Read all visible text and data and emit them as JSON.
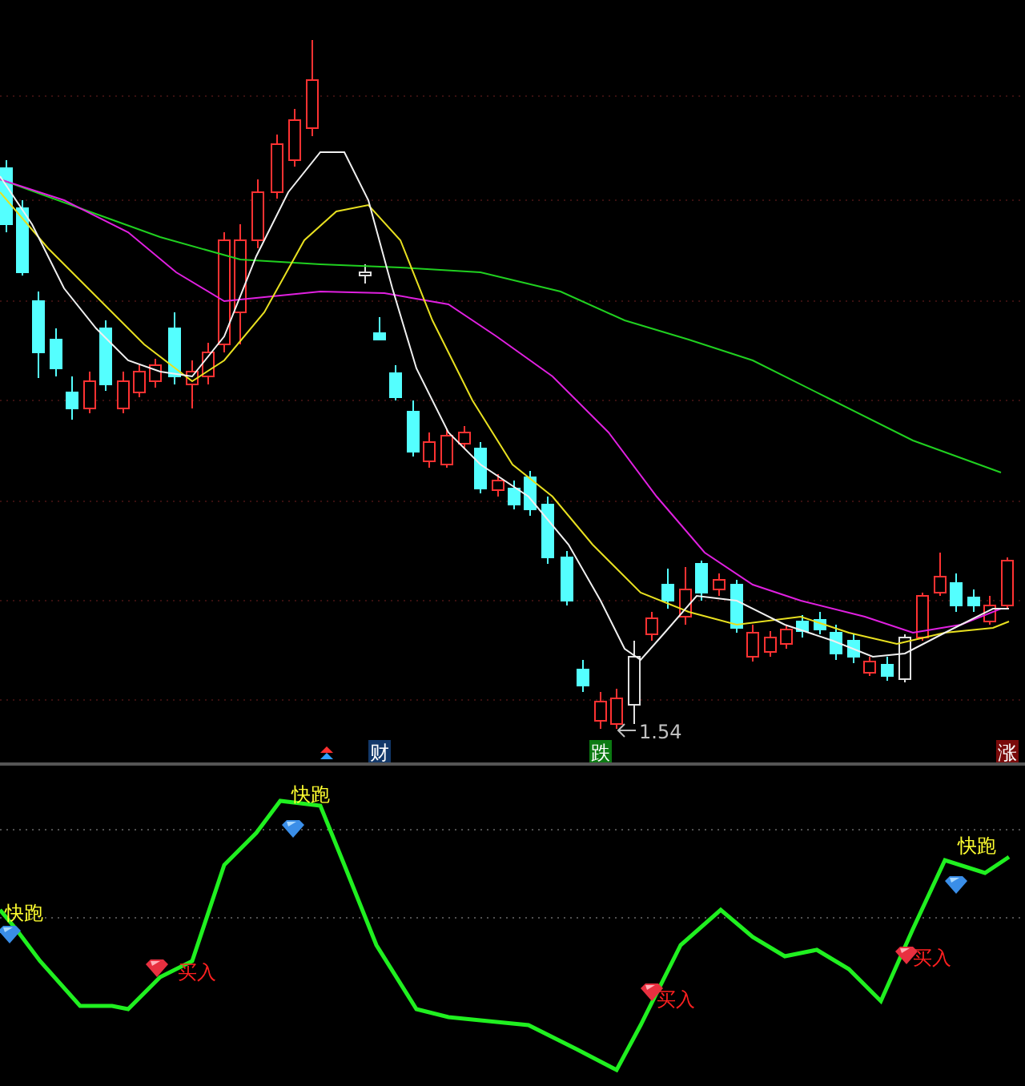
{
  "price_panel": {
    "low_label": "1.54",
    "event_badges": [
      {
        "text": "财",
        "color": "#12386a"
      },
      {
        "text": "跌",
        "color": "#0b7a12"
      },
      {
        "text": "涨",
        "color": "#7a0a0a"
      }
    ]
  },
  "indicator_panel": {
    "signals": [
      {
        "kind": "sell",
        "text": "快跑"
      },
      {
        "kind": "buy",
        "text": "买入"
      },
      {
        "kind": "sell",
        "text": "快跑"
      },
      {
        "kind": "buy",
        "text": "买入"
      },
      {
        "kind": "buy",
        "text": "买入"
      },
      {
        "kind": "sell",
        "text": "快跑"
      }
    ]
  }
}
